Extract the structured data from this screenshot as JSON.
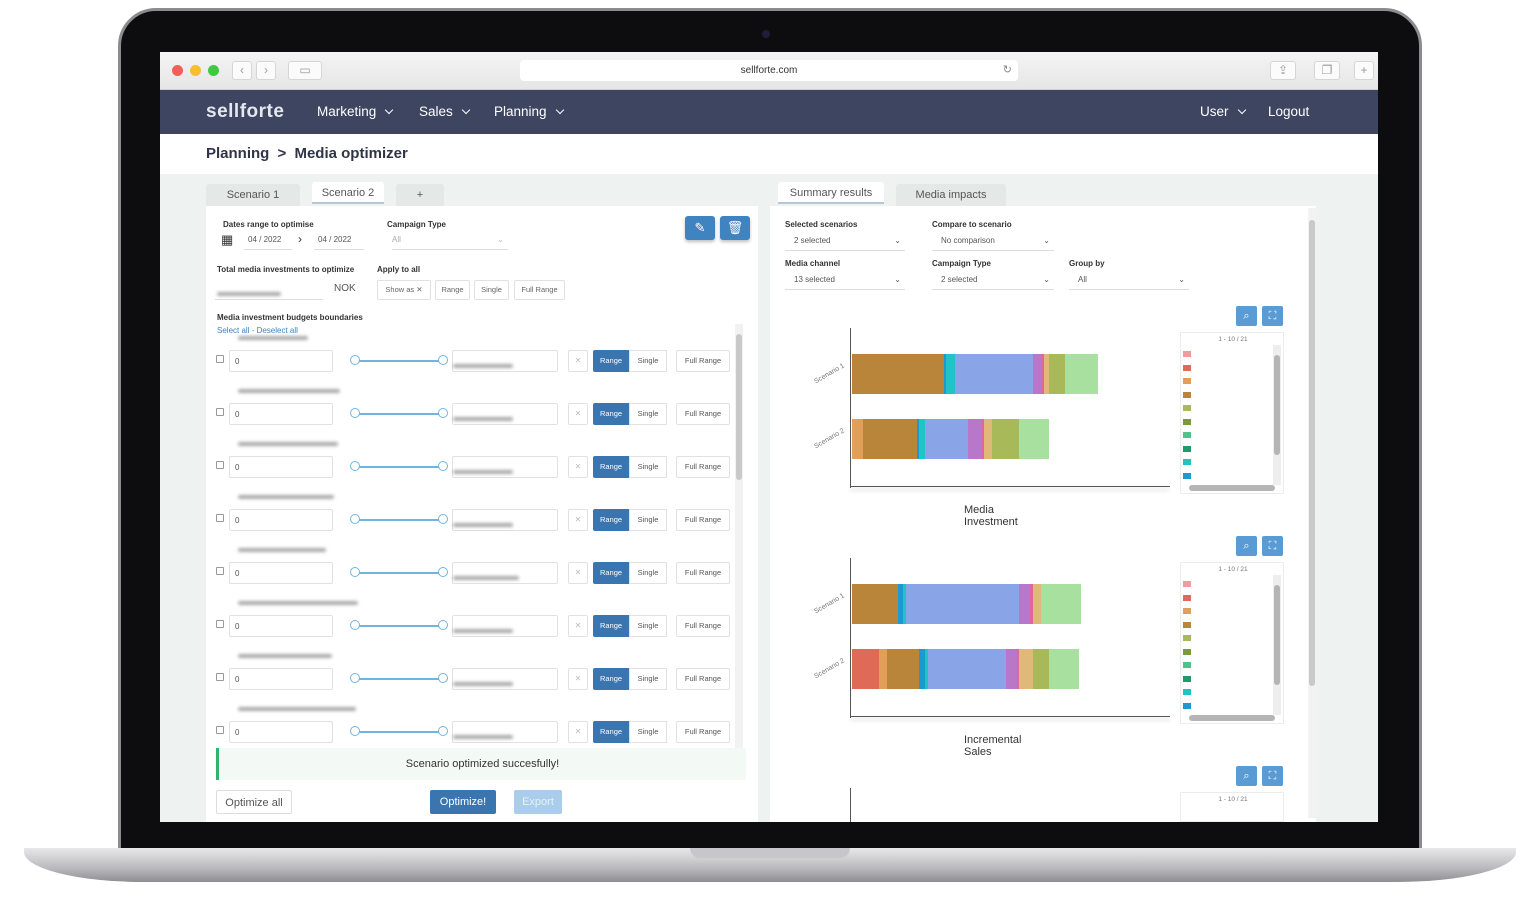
{
  "browser": {
    "url": "sellforte.com"
  },
  "nav": {
    "logo": "sellforte",
    "menu": [
      {
        "label": "Marketing"
      },
      {
        "label": "Sales"
      },
      {
        "label": "Planning"
      }
    ],
    "user_label": "User",
    "logout_label": "Logout"
  },
  "breadcrumb": {
    "parent": "Planning",
    "separator": ">",
    "current": "Media optimizer"
  },
  "left": {
    "tabs": [
      "Scenario 1",
      "Scenario 2",
      "+"
    ],
    "active_tab": "Scenario 2",
    "dates_label": "Dates range to optimise",
    "date_from": "04 / 2022",
    "date_to": "04 / 2022",
    "campaign_type_label": "Campaign Type",
    "campaign_type_value": "All",
    "total_label": "Total media investments to optimize",
    "currency": "NOK",
    "apply_all_label": "Apply to all",
    "show_as_label": "Show as",
    "range_label": "Range",
    "single_label": "Single",
    "full_range_label": "Full Range",
    "boundaries_label": "Media investment budgets boundaries",
    "select_all": "Select all",
    "select_sep": " - ",
    "deselect_all": "Deselect all",
    "row_value": "0",
    "row_x": "✕",
    "success_message": "Scenario optimized succesfully!",
    "optimize_all_label": "Optimize all",
    "optimize_label": "Optimize!",
    "export_label": "Export",
    "accent_color": "#3a75b0",
    "success_color": "#2fb36d"
  },
  "right": {
    "tabs": [
      "Summary results",
      "Media impacts"
    ],
    "active_tab": "Summary results",
    "selected_scenarios_label": "Selected scenarios",
    "selected_scenarios_value": "2 selected",
    "compare_label": "Compare to scenario",
    "compare_value": "No comparison",
    "media_channel_label": "Media channel",
    "media_channel_value": "13 selected",
    "campaign_type_label": "Campaign Type",
    "campaign_type_value": "2 selected",
    "group_by_label": "Group by",
    "group_by_value": "All",
    "legend_pager_1": "1 - 10 / 21",
    "legend_pager_2": "1 - 10 / 21",
    "legend_pager_3": "1 - 10 / 21",
    "legend_swatch_colors": [
      "#f29b9b",
      "#e06a58",
      "#e0a05a",
      "#b8853a",
      "#a8b95a",
      "#7a9b3a",
      "#4fc48a",
      "#1f9a6a",
      "#1fc4c4",
      "#1a9ad0"
    ]
  },
  "chart_data": [
    {
      "type": "bar",
      "title": "Media Investment",
      "categories": [
        "Scenario 1",
        "Scenario 2"
      ],
      "orientation": "horizontal",
      "stacked": true,
      "segment_colors": [
        "#e06a58",
        "#e0a05a",
        "#b8853a",
        "#1a9ad0",
        "#1fc4c4",
        "#8aa4e8",
        "#b877c9",
        "#e066a0",
        "#e0b87a",
        "#a8b95a",
        "#a8e0a0"
      ],
      "series": [
        {
          "values": [
            0,
            0
          ]
        },
        {
          "values": [
            0,
            4
          ]
        },
        {
          "values": [
            34,
            20
          ]
        },
        {
          "values": [
            1,
            1
          ]
        },
        {
          "values": [
            3,
            2
          ]
        },
        {
          "values": [
            29,
            16
          ]
        },
        {
          "values": [
            3,
            5
          ]
        },
        {
          "values": [
            1,
            1
          ]
        },
        {
          "values": [
            2,
            3
          ]
        },
        {
          "values": [
            6,
            10
          ]
        },
        {
          "values": [
            12,
            11
          ]
        }
      ]
    },
    {
      "type": "bar",
      "title": "Incremental Sales",
      "categories": [
        "Scenario 1",
        "Scenario 2"
      ],
      "orientation": "horizontal",
      "stacked": true,
      "segment_colors": [
        "#e06a58",
        "#e0a05a",
        "#b8853a",
        "#1a9ad0",
        "#1fc4c4",
        "#8aa4e8",
        "#b877c9",
        "#e066a0",
        "#e0b87a",
        "#a8b95a",
        "#a8e0a0"
      ],
      "series": [
        {
          "values": [
            0,
            10
          ]
        },
        {
          "values": [
            0,
            3
          ]
        },
        {
          "values": [
            17,
            12
          ]
        },
        {
          "values": [
            2,
            2
          ]
        },
        {
          "values": [
            1,
            1
          ]
        },
        {
          "values": [
            42,
            29
          ]
        },
        {
          "values": [
            4,
            4
          ]
        },
        {
          "values": [
            1,
            1
          ]
        },
        {
          "values": [
            3,
            5
          ]
        },
        {
          "values": [
            0,
            6
          ]
        },
        {
          "values": [
            15,
            11
          ]
        }
      ]
    }
  ]
}
